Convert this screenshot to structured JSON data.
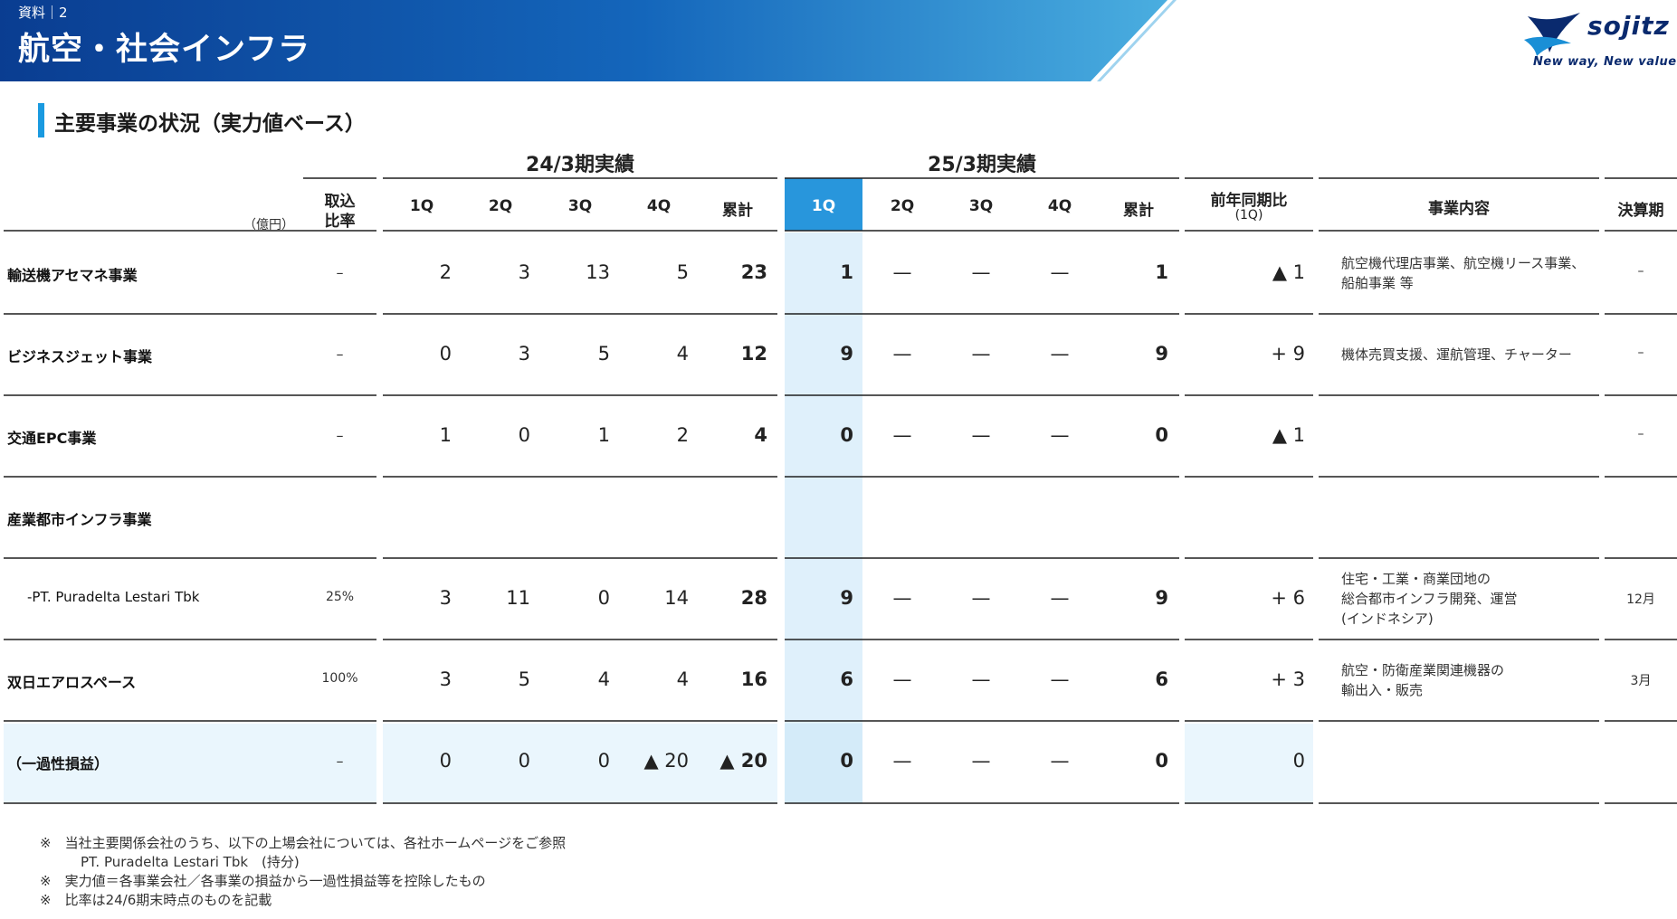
{
  "header": {
    "doc_label": "資料｜2",
    "title": "航空・社会インフラ",
    "logo_text": "sojitz",
    "logo_tagline": "New way, New value"
  },
  "section": {
    "title": "主要事業の状況（実力値ベース）"
  },
  "table": {
    "unit_label": "（億円）",
    "group_fy24": "24/3期実績",
    "group_fy25": "25/3期実績",
    "col_ratio_line1": "取込",
    "col_ratio_line2": "比率",
    "quarters": [
      "1Q",
      "2Q",
      "3Q",
      "4Q",
      "累計"
    ],
    "col_yoy_line1": "前年同期比",
    "col_yoy_line2": "(1Q)",
    "col_business": "事業内容",
    "col_fiscal": "決算期",
    "rows": [
      {
        "label": "輸送機アセマネ事業",
        "ratio": "–",
        "fy24": [
          "2",
          "3",
          "13",
          "5",
          "23"
        ],
        "fy25": [
          "1",
          "—",
          "—",
          "—",
          "1"
        ],
        "yoy": "▲ 1",
        "desc": [
          "航空機代理店事業、航空機リース事業、",
          "船舶事業 等"
        ],
        "fiscal": "–"
      },
      {
        "label": "ビジネスジェット事業",
        "ratio": "–",
        "fy24": [
          "0",
          "3",
          "5",
          "4",
          "12"
        ],
        "fy25": [
          "9",
          "—",
          "—",
          "—",
          "9"
        ],
        "yoy": "+ 9",
        "desc": [
          "機体売買支援、運航管理、チャーター"
        ],
        "fiscal": "–"
      },
      {
        "label": "交通EPC事業",
        "ratio": "–",
        "fy24": [
          "1",
          "0",
          "1",
          "2",
          "4"
        ],
        "fy25": [
          "0",
          "—",
          "—",
          "—",
          "0"
        ],
        "yoy": "▲ 1",
        "desc": [],
        "fiscal": "–"
      },
      {
        "label": "産業都市インフラ事業"
      },
      {
        "label": "-PT. Puradelta Lestari Tbk",
        "ratio": "25%",
        "fy24": [
          "3",
          "11",
          "0",
          "14",
          "28"
        ],
        "fy25": [
          "9",
          "—",
          "—",
          "—",
          "9"
        ],
        "yoy": "+ 6",
        "desc": [
          "住宅・工業・商業団地の",
          "総合都市インフラ開発、運営",
          "(インドネシア)"
        ],
        "fiscal": "12月"
      },
      {
        "label": "双日エアロスペース",
        "ratio": "100%",
        "fy24": [
          "3",
          "5",
          "4",
          "4",
          "16"
        ],
        "fy25": [
          "6",
          "—",
          "—",
          "—",
          "6"
        ],
        "yoy": "+ 3",
        "desc": [
          "航空・防衛産業関連機器の",
          "輸出入・販売"
        ],
        "fiscal": "3月"
      },
      {
        "label": "（一過性損益）",
        "ratio": "–",
        "fy24": [
          "0",
          "0",
          "0",
          "▲ 20",
          "▲ 20"
        ],
        "fy25": [
          "0",
          "—",
          "—",
          "—",
          "0"
        ],
        "yoy": "0",
        "desc": [],
        "fiscal": ""
      }
    ]
  },
  "footnotes": [
    "※　当社主要関係会社のうち、以下の上場会社については、各社ホームページをご参照",
    "　　　PT. Puradelta Lestari Tbk　(持分)",
    "※　実力値＝各事業会社／各事業の損益から一過性損益等を控除したもの",
    "※　比率は24/6期末時点のものを記載"
  ],
  "colors": {
    "banner_dark": "#0a3d91",
    "banner_light": "#4aaee0",
    "accent_blue": "#1a9ae0",
    "highlight_header": "#2896dc",
    "highlight_col": "#dff0fb",
    "onetime_row": "#eaf6fd"
  }
}
